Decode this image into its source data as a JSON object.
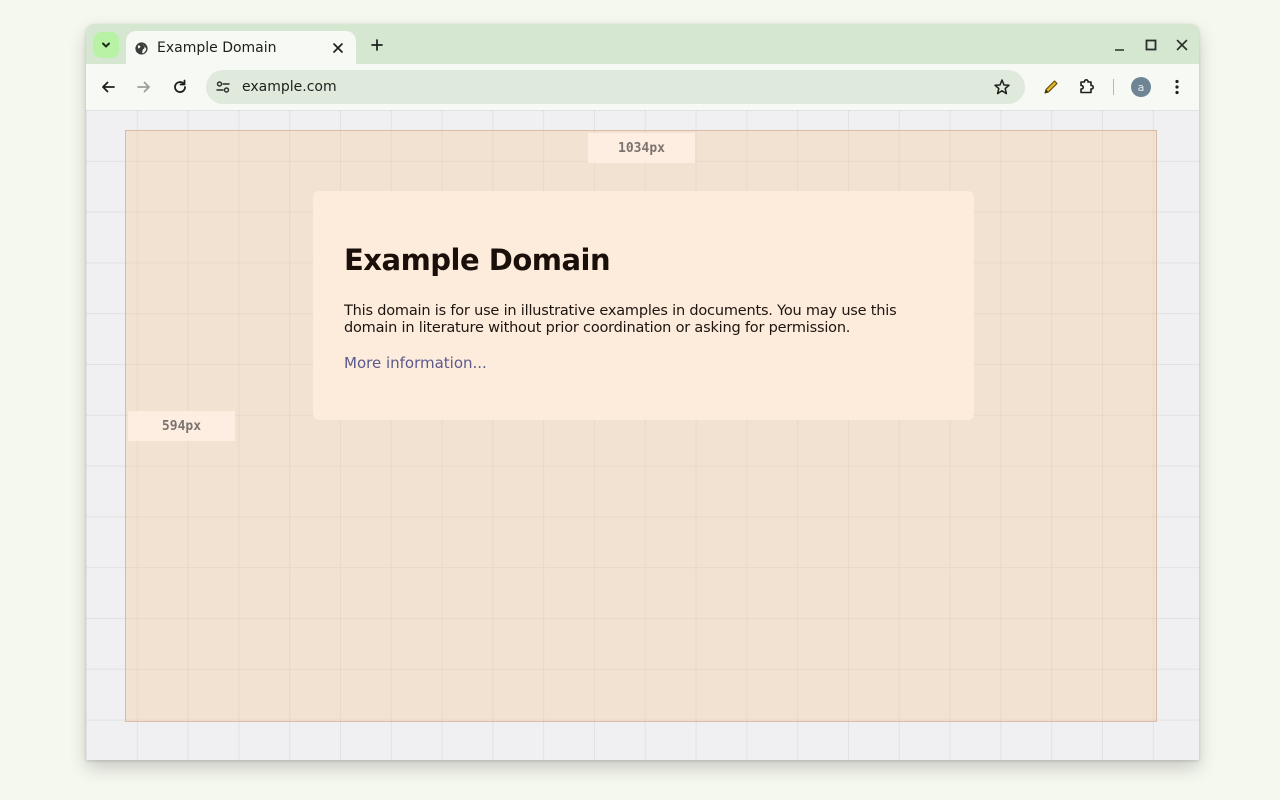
{
  "browser": {
    "tab": {
      "title": "Example Domain"
    },
    "address_bar": {
      "url": "example.com"
    },
    "profile": {
      "initial": "a"
    }
  },
  "inspector_overlay": {
    "width_label": "1034px",
    "height_label": "594px"
  },
  "page": {
    "heading": "Example Domain",
    "body": "This domain is for use in illustrative examples in documents. You may use this domain in literature without prior coordination or asking for permission.",
    "link": "More information..."
  },
  "colors": {
    "tabstrip": "#d5e7d0",
    "toolbar": "#f6f9f4",
    "omnibox": "#dfe9dc",
    "overlay": "#f5c896",
    "card": "#fdebdc",
    "link": "#5a5a8c"
  },
  "icons": [
    "tab-search-icon",
    "globe-icon",
    "close-icon",
    "plus-icon",
    "minimize-icon",
    "maximize-icon",
    "back-icon",
    "forward-icon",
    "reload-icon",
    "site-settings-icon",
    "star-icon",
    "pencil-icon",
    "puzzle-icon",
    "more-vert-icon"
  ]
}
